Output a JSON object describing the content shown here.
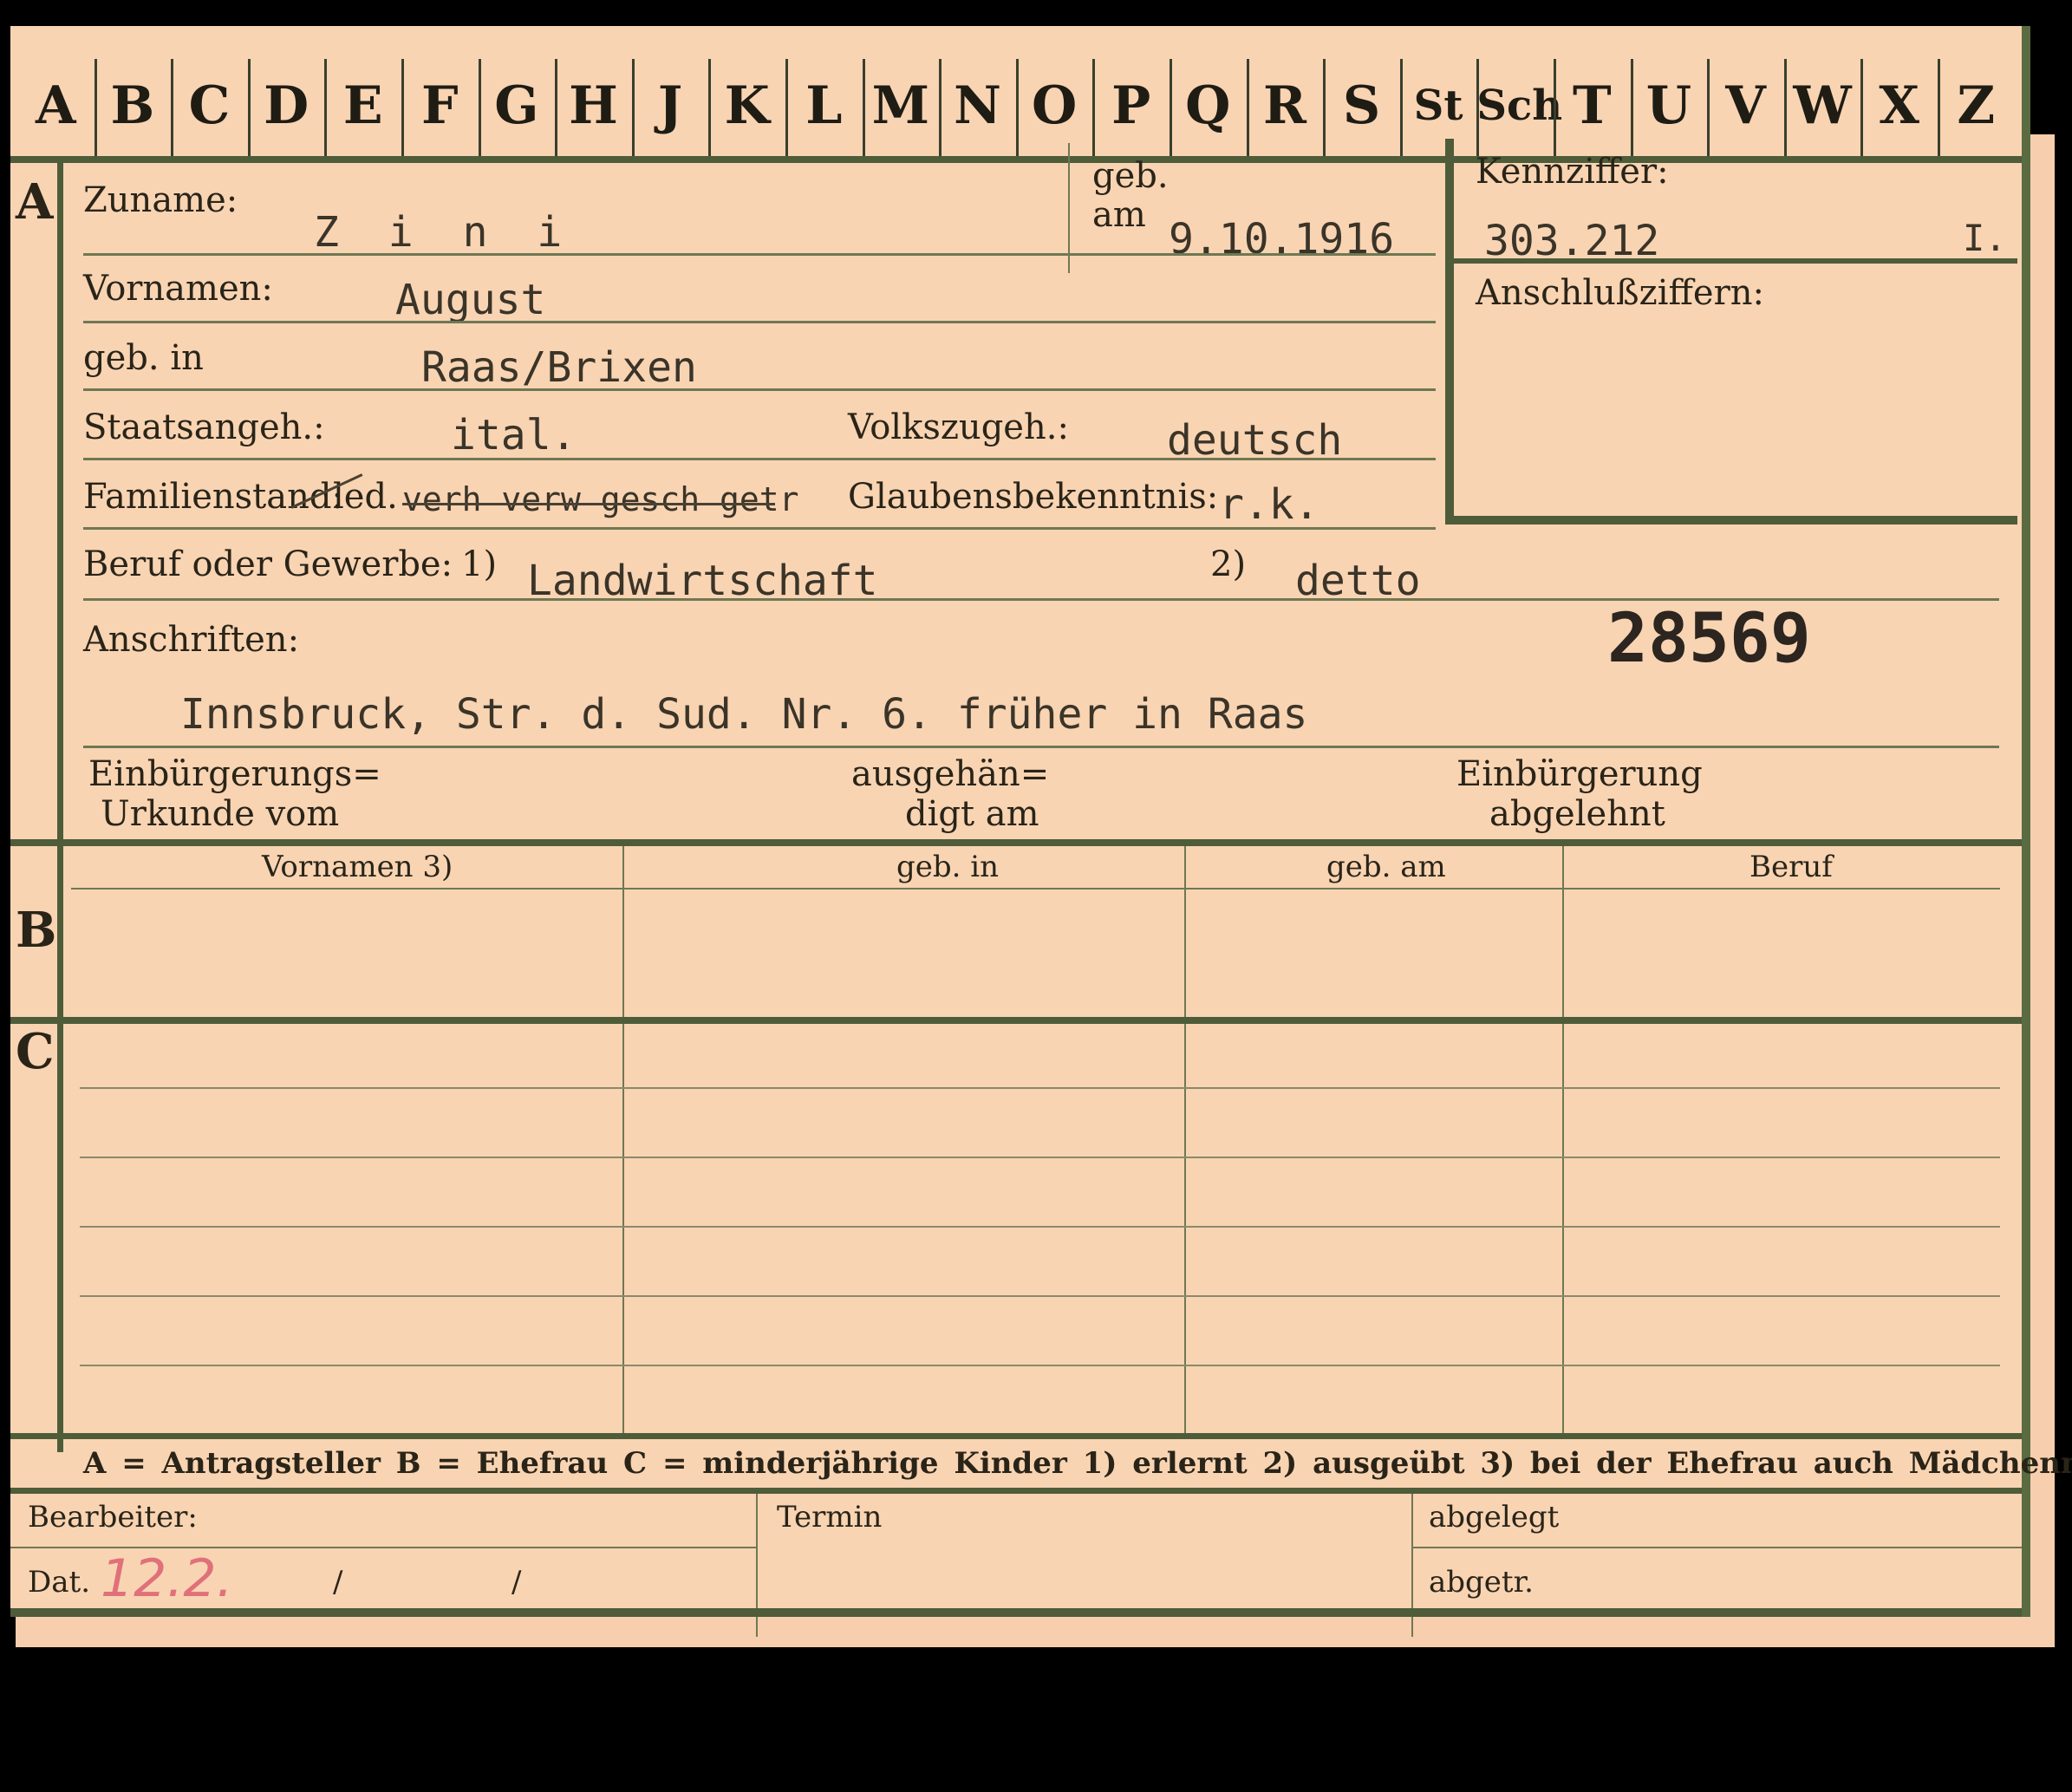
{
  "alphabet": [
    "A",
    "B",
    "C",
    "D",
    "E",
    "F",
    "G",
    "H",
    "J",
    "K",
    "L",
    "M",
    "N",
    "O",
    "P",
    "Q",
    "R",
    "S",
    "St",
    "Sch",
    "T",
    "U",
    "V",
    "W",
    "X",
    "Z"
  ],
  "sections": {
    "a": "A",
    "b": "B",
    "c": "C"
  },
  "labels": {
    "zuname": "Zuname:",
    "geb": "geb.",
    "am": "am",
    "kennziffer": "Kennziffer:",
    "anschlussziffern": "Anschlußziffern:",
    "vornamen": "Vornamen:",
    "geb_in": "geb. in",
    "staatsangeh": "Staatsangeh.:",
    "volkszugeh": "Volkszugeh.:",
    "familienstand": "Familienstand:",
    "glaubensbekenntnis": "Glaubensbekenntnis:",
    "beruf": "Beruf oder Gewerbe:",
    "fn1": "1)",
    "fn2": "2)",
    "anschriften": "Anschriften:",
    "einbuergerungs_urkunde_1": "Einbürgerungs=",
    "einbuergerungs_urkunde_2": "Urkunde vom",
    "ausgehaendigt_1": "ausgehän=",
    "ausgehaendigt_2": "digt am",
    "einbuergerung_abgelehnt_1": "Einbürgerung",
    "einbuergerung_abgelehnt_2": "abgelehnt"
  },
  "values": {
    "zuname": "Z i n i",
    "geb_am": "9.10.1916",
    "kennziffer": "303.212",
    "kennziffer_suffix": "I.",
    "vornamen": "August",
    "geb_in": "Raas/Brixen",
    "staatsangeh": "ital.",
    "volkszugeh": "deutsch",
    "familienstand_prefix": "led.",
    "familienstand_struck": "verh verw gesch getr",
    "glaubensbekenntnis": "r.k.",
    "beruf1": "Landwirtschaft",
    "beruf2": "detto",
    "stamp_number": "28569",
    "anschrift": "Innsbruck, Str. d. Sud. Nr. 6. früher in Raas"
  },
  "table_headers": [
    "Vornamen 3)",
    "geb. in",
    "geb. am",
    "Beruf"
  ],
  "legend": "A = Antragsteller   B = Ehefrau   C = minderjährige Kinder   1) erlernt   2) ausgeübt   3) bei der Ehefrau auch Mädchenname",
  "footer": {
    "bearbeiter": "Bearbeiter:",
    "dat": "Dat.",
    "dat_value": "12.2.",
    "slash1": "/",
    "slash2": "/",
    "termin": "Termin",
    "abgelegt": "abgelegt",
    "abgetr": "abgetr."
  },
  "colors": {
    "paper": "#f8d4b3",
    "rule": "#6f7853",
    "frame": "#4e5c39",
    "red_ink": "#e0707a"
  }
}
